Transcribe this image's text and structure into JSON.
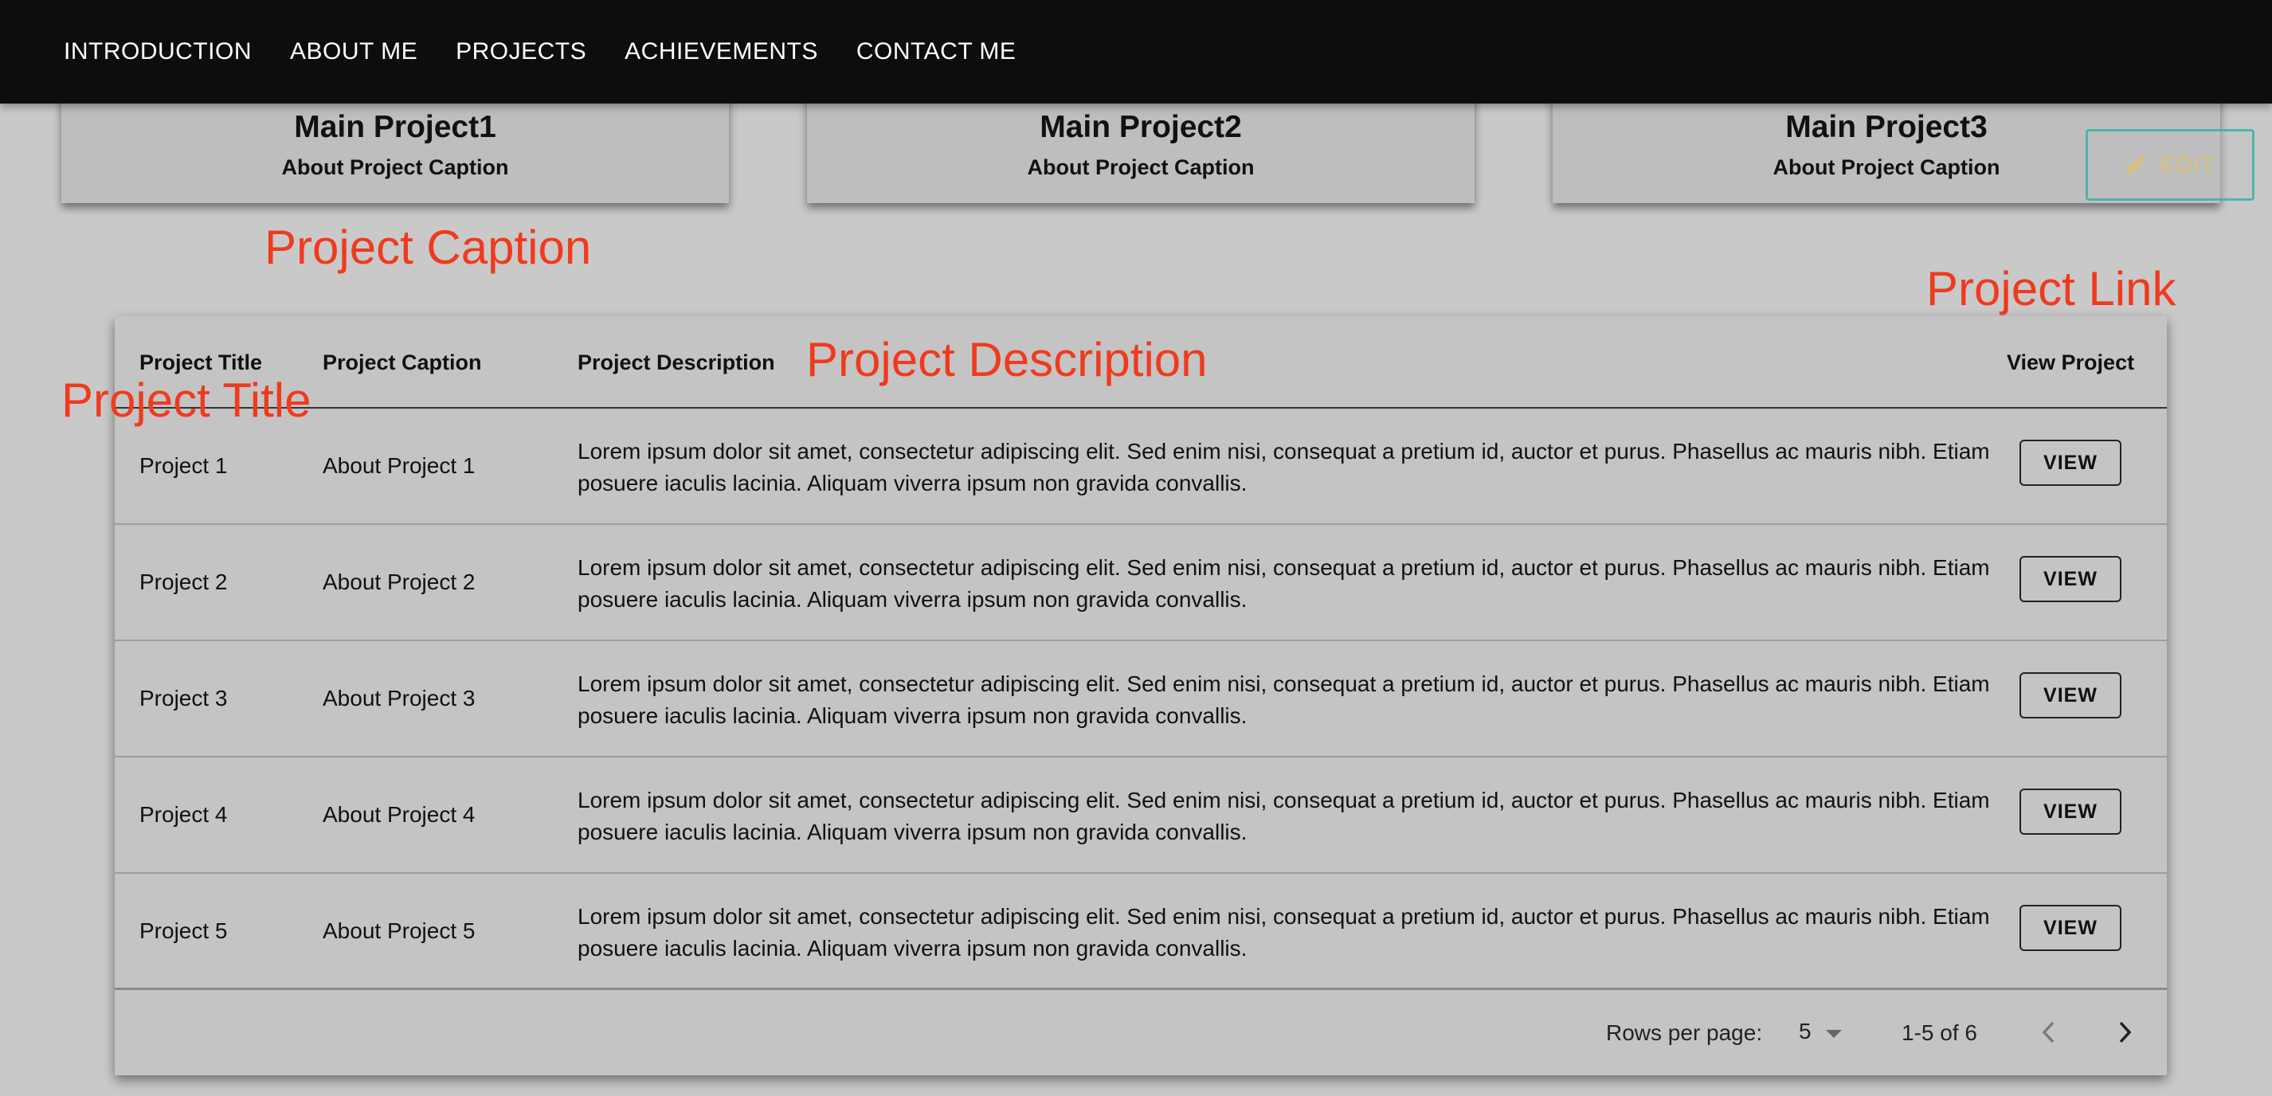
{
  "nav": {
    "items": [
      "INTRODUCTION",
      "ABOUT ME",
      "PROJECTS",
      "ACHIEVEMENTS",
      "CONTACT ME"
    ]
  },
  "main_projects": [
    {
      "title": "Main Project1",
      "caption": "About Project Caption"
    },
    {
      "title": "Main Project2",
      "caption": "About Project Caption"
    },
    {
      "title": "Main Project3",
      "caption": "About Project Caption"
    }
  ],
  "edit_button": {
    "label": "EDIT",
    "icon": "pencil-icon"
  },
  "annotations": {
    "project_caption": "Project Caption",
    "project_link": "Project Link",
    "project_description": "Project Description",
    "project_title": "Project Title"
  },
  "table": {
    "columns": [
      "Project Title",
      "Project Caption",
      "Project Description",
      "View Project"
    ],
    "rows": [
      {
        "title": "Project 1",
        "caption": "About Project 1",
        "description": "Lorem ipsum dolor sit amet, consectetur adipiscing elit. Sed enim nisi, consequat a pretium id, auctor et purus. Phasellus ac mauris nibh. Etiam posuere iaculis lacinia. Aliquam viverra ipsum non gravida convallis.",
        "action": "VIEW"
      },
      {
        "title": "Project 2",
        "caption": "About Project 2",
        "description": "Lorem ipsum dolor sit amet, consectetur adipiscing elit. Sed enim nisi, consequat a pretium id, auctor et purus. Phasellus ac mauris nibh. Etiam posuere iaculis lacinia. Aliquam viverra ipsum non gravida convallis.",
        "action": "VIEW"
      },
      {
        "title": "Project 3",
        "caption": "About Project 3",
        "description": "Lorem ipsum dolor sit amet, consectetur adipiscing elit. Sed enim nisi, consequat a pretium id, auctor et purus. Phasellus ac mauris nibh. Etiam posuere iaculis lacinia. Aliquam viverra ipsum non gravida convallis.",
        "action": "VIEW"
      },
      {
        "title": "Project 4",
        "caption": "About Project 4",
        "description": "Lorem ipsum dolor sit amet, consectetur adipiscing elit. Sed enim nisi, consequat a pretium id, auctor et purus. Phasellus ac mauris nibh. Etiam posuere iaculis lacinia. Aliquam viverra ipsum non gravida convallis.",
        "action": "VIEW"
      },
      {
        "title": "Project 5",
        "caption": "About Project 5",
        "description": "Lorem ipsum dolor sit amet, consectetur adipiscing elit. Sed enim nisi, consequat a pretium id, auctor et purus. Phasellus ac mauris nibh. Etiam posuere iaculis lacinia. Aliquam viverra ipsum non gravida convallis.",
        "action": "VIEW"
      }
    ],
    "pagination": {
      "rows_per_page_label": "Rows per page:",
      "rows_per_page_value": "5",
      "range_text": "1-5 of 6",
      "prev_icon": "chevron-left-icon",
      "next_icon": "chevron-right-icon",
      "dropdown_icon": "caret-down-icon"
    }
  },
  "colors": {
    "navbar_bg": "#0d0d0d",
    "page_bg": "#c9c9c9",
    "annotation": "#f03a1e",
    "edit_border": "#2fb3a7",
    "edit_text": "#e7c25a"
  }
}
